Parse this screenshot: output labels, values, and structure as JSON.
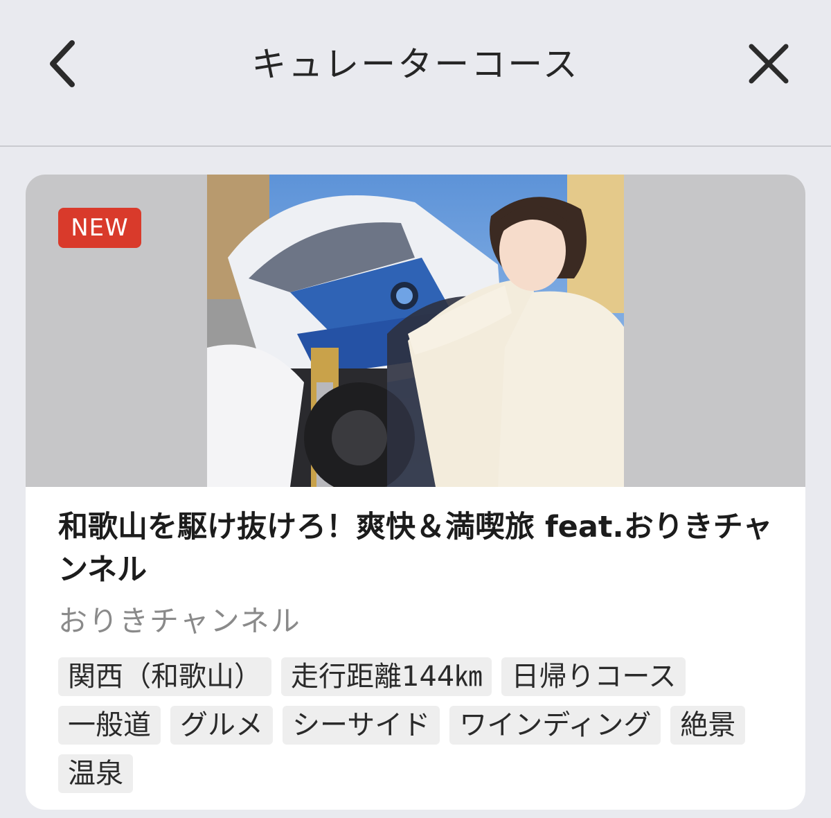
{
  "header": {
    "title": "キュレーターコース",
    "back_icon": "chevron-left-icon",
    "close_icon": "close-icon"
  },
  "course": {
    "badge": "NEW",
    "title": "和歌山を駆け抜けろ！爽快＆満喫旅 feat.おりきチャンネル",
    "author": "おりきチャンネル",
    "tags": [
      "関西（和歌山）",
      "走行距離144㎞",
      "日帰りコース",
      "一般道",
      "グルメ",
      "シーサイド",
      "ワインディング",
      "絶景",
      "温泉"
    ]
  },
  "colors": {
    "background": "#e9eaef",
    "badge": "#d93a2b",
    "author_text": "#8a8a8a",
    "tag_bg": "#eeeeee"
  }
}
